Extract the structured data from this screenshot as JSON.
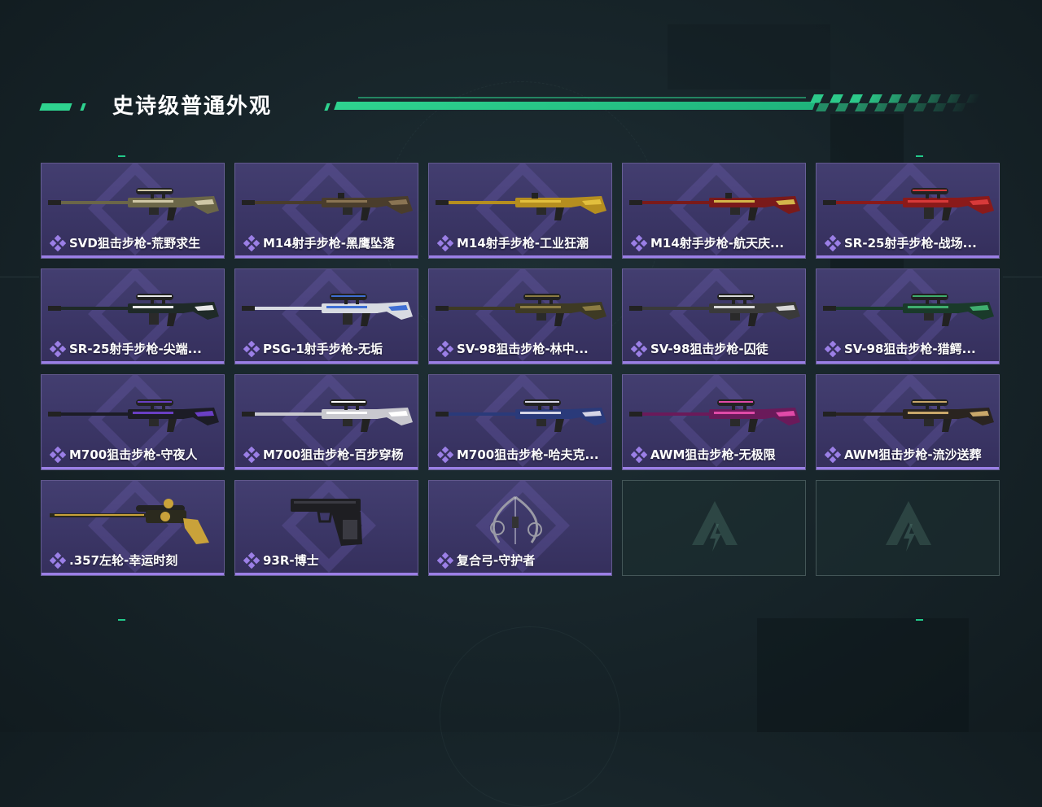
{
  "header": {
    "title": "史诗级普通外观"
  },
  "colors": {
    "accent": "#2ed38f",
    "rarity_epic": "#9b7fe6",
    "card_bg": "#3b3666"
  },
  "skins": [
    {
      "name": "SVD狙击步枪-荒野求生",
      "kind": "sniper",
      "body": "#6b6648",
      "trim": "#cfc7a6"
    },
    {
      "name": "M14射手步枪-黑鹰坠落",
      "kind": "rifle",
      "body": "#4a3d2c",
      "trim": "#8a7453"
    },
    {
      "name": "M14射手步枪-工业狂潮",
      "kind": "rifle",
      "body": "#b58e1f",
      "trim": "#e2bf3d"
    },
    {
      "name": "M14射手步枪-航天庆...",
      "kind": "rifle",
      "body": "#7a1a1a",
      "trim": "#d4b54a"
    },
    {
      "name": "SR-25射手步枪-战场...",
      "kind": "ar",
      "body": "#8a1a1a",
      "trim": "#d83a3a"
    },
    {
      "name": "SR-25射手步枪-尖端...",
      "kind": "ar",
      "body": "#1f2a28",
      "trim": "#e8e8e8"
    },
    {
      "name": "PSG-1射手步枪-无垢",
      "kind": "ar",
      "body": "#d8dbe2",
      "trim": "#3f6fd4"
    },
    {
      "name": "SV-98狙击步枪-林中...",
      "kind": "sniper",
      "body": "#3e3a24",
      "trim": "#8c7c43"
    },
    {
      "name": "SV-98狙击步枪-囚徒",
      "kind": "sniper",
      "body": "#3a3a3a",
      "trim": "#d8d8d8"
    },
    {
      "name": "SV-98狙击步枪-猎鳄...",
      "kind": "sniper",
      "body": "#1a3a2a",
      "trim": "#3fae6f"
    },
    {
      "name": "M700狙击步枪-守夜人",
      "kind": "sniper",
      "body": "#1c1c26",
      "trim": "#6a3fc4"
    },
    {
      "name": "M700狙击步枪-百步穿杨",
      "kind": "sniper",
      "body": "#c9c9cf",
      "trim": "#ffffff"
    },
    {
      "name": "M700狙击步枪-哈夫克...",
      "kind": "sniper",
      "body": "#2a3a7a",
      "trim": "#d6d6e6"
    },
    {
      "name": "AWM狙击步枪-无极限",
      "kind": "sniper",
      "body": "#6a1a5a",
      "trim": "#e04aa8"
    },
    {
      "name": "AWM狙击步枪-流沙送葬",
      "kind": "sniper",
      "body": "#2a2420",
      "trim": "#c9a76a"
    },
    {
      "name": ".357左轮-幸运时刻",
      "kind": "revolver",
      "body": "#2b2a1e",
      "trim": "#c9a23a"
    },
    {
      "name": "93R-博士",
      "kind": "pistol",
      "body": "#1e1e22",
      "trim": "#3a3a42"
    },
    {
      "name": "复合弓-守护者",
      "kind": "bow",
      "body": "#9a9aa6",
      "trim": "#d4d4de"
    }
  ],
  "empty_slots": 2
}
